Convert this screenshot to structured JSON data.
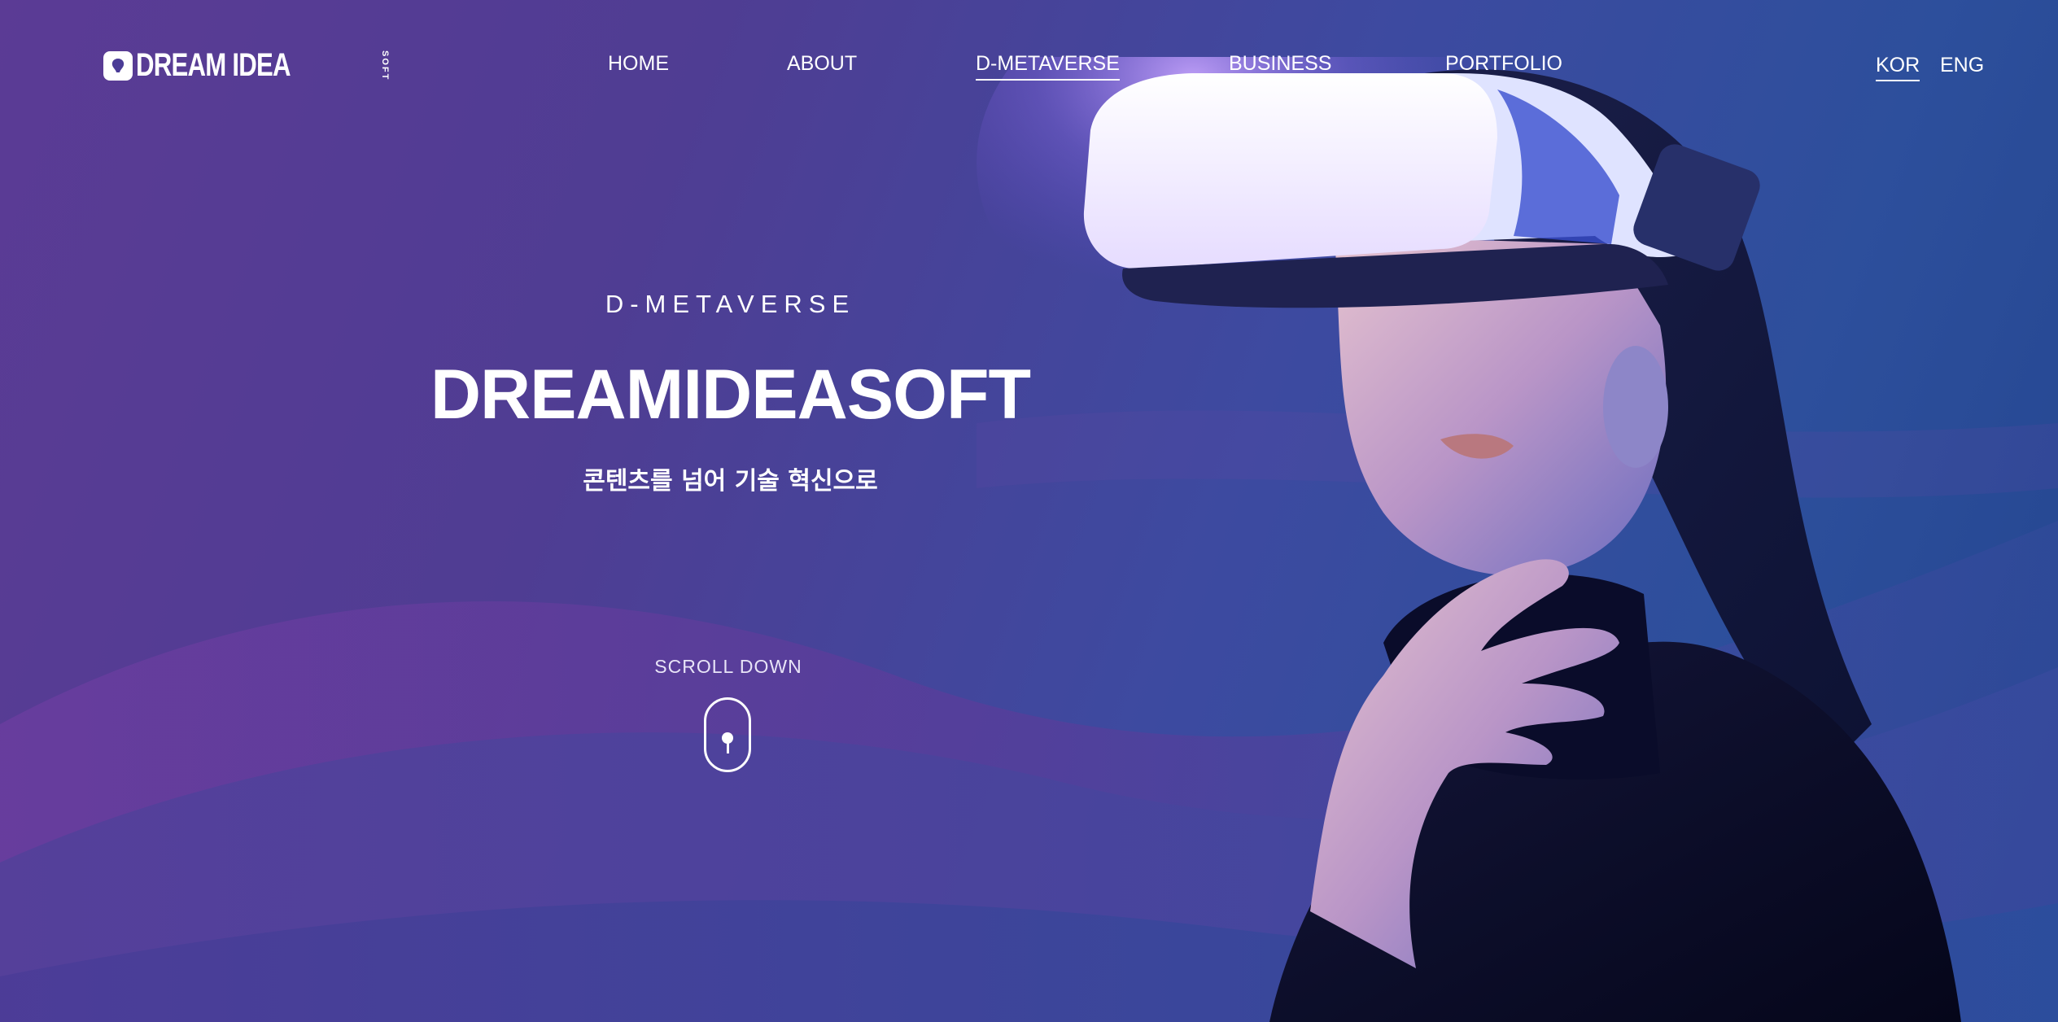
{
  "brand": {
    "logo_text": "DREAM IDEA",
    "logo_sub": "SOFT"
  },
  "nav": {
    "items": [
      {
        "label": "HOME"
      },
      {
        "label": "ABOUT"
      },
      {
        "label": "D-METAVERSE",
        "active": true
      },
      {
        "label": "BUSINESS"
      },
      {
        "label": "PORTFOLIO"
      }
    ]
  },
  "language": {
    "kor": "KOR",
    "eng": "ENG",
    "active": "KOR"
  },
  "hero": {
    "eyebrow": "D-METAVERSE",
    "headline": "DREAMIDEASOFT",
    "subline": "콘텐츠를 넘어 기술 혁신으로",
    "scroll_label": "SCROLL DOWN"
  },
  "colors": {
    "background_start": "#5b3b95",
    "background_end": "#23458f",
    "text": "#ffffff",
    "headset_glow": "#b48cff"
  },
  "icons": {
    "logo": "dream-idea-logo-icon",
    "scroll": "mouse-scroll-icon"
  }
}
